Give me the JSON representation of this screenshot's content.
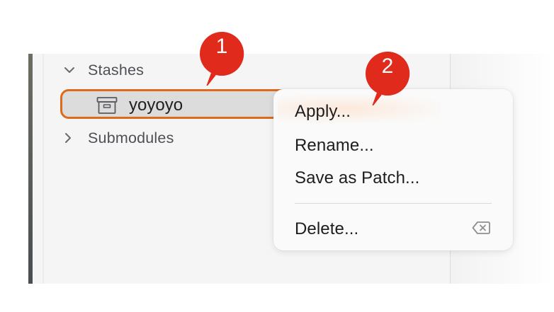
{
  "sidebar": {
    "stashes_header": "Stashes",
    "stash_items": [
      {
        "label": "yoyoyo"
      }
    ],
    "submodules_header": "Submodules"
  },
  "context_menu": {
    "items": [
      {
        "label": "Apply..."
      },
      {
        "label": "Rename..."
      },
      {
        "label": "Save as Patch..."
      },
      {
        "label": "Delete..."
      }
    ],
    "delete_shortcut_icon": "delete-backward-icon"
  },
  "callouts": [
    {
      "number": "1"
    },
    {
      "number": "2"
    }
  ],
  "colors": {
    "selection_border": "#dd6a1e",
    "callout_red": "#e02a1c"
  }
}
